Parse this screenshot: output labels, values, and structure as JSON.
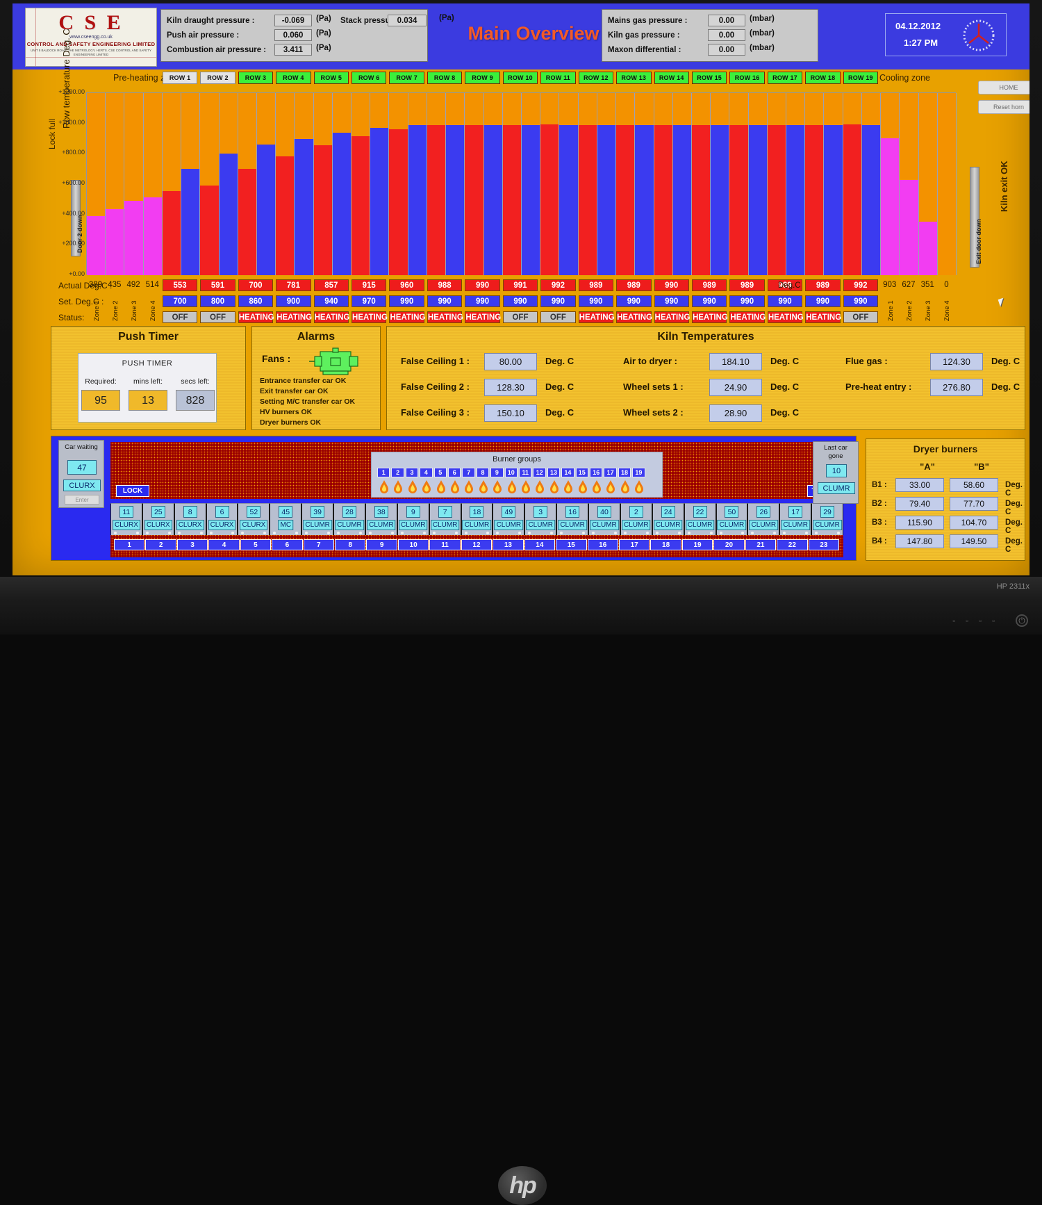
{
  "header": {
    "title": "Main Overview",
    "logo": {
      "name": "C S E",
      "url": "www.cseengg.co.uk",
      "subtitle": "CONTROL AND SAFETY ENGINEERING LIMITED",
      "fineprint": "UNIT 5 BALDOCK ROAD, THE METROLOGY, HERTS.\nCSE CONTROL AND SAFETY ENGINEERING LIMITED"
    },
    "pressures_left": [
      {
        "label": "Kiln draught pressure :",
        "value": "-0.069",
        "unit": "(Pa)"
      },
      {
        "label": "Push air pressure :",
        "value": "0.060",
        "unit": "(Pa)"
      },
      {
        "label": "Combustion air pressure :",
        "value": "3.411",
        "unit": "(Pa)"
      }
    ],
    "stack": {
      "label": "Stack pressure :",
      "value": "0.034",
      "unit": "(Pa)"
    },
    "pressures_right": [
      {
        "label": "Mains gas pressure :",
        "value": "0.00",
        "unit": "(mbar)"
      },
      {
        "label": "Kiln gas pressure :",
        "value": "0.00",
        "unit": "(mbar)"
      },
      {
        "label": "Maxon differential :",
        "value": "0.00",
        "unit": "(mbar)"
      }
    ],
    "clock": {
      "date": "04.12.2012",
      "time": "1:27 PM"
    }
  },
  "chart_region": {
    "preheat_label": "Pre-heating zone",
    "cooling_label": "Cooling zone",
    "lock_full_label": "Lock full",
    "kiln_exit_label": "Kiln exit OK",
    "door2_label": "Door 2 down",
    "exit_door_label": "Exit door down",
    "home_button": "HOME",
    "reset_horn_button": "Reset horn",
    "row_buttons": [
      {
        "label": "ROW 1",
        "state": "off"
      },
      {
        "label": "ROW 2",
        "state": "off"
      },
      {
        "label": "ROW 3",
        "state": "on"
      },
      {
        "label": "ROW 4",
        "state": "on"
      },
      {
        "label": "ROW 5",
        "state": "on"
      },
      {
        "label": "ROW 6",
        "state": "on"
      },
      {
        "label": "ROW 7",
        "state": "on"
      },
      {
        "label": "ROW 8",
        "state": "on"
      },
      {
        "label": "ROW 9",
        "state": "on"
      },
      {
        "label": "ROW 10",
        "state": "on"
      },
      {
        "label": "ROW 11",
        "state": "on"
      },
      {
        "label": "ROW 12",
        "state": "on"
      },
      {
        "label": "ROW 13",
        "state": "on"
      },
      {
        "label": "ROW 14",
        "state": "on"
      },
      {
        "label": "ROW 15",
        "state": "on"
      },
      {
        "label": "ROW 16",
        "state": "on"
      },
      {
        "label": "ROW 17",
        "state": "on"
      },
      {
        "label": "ROW 18",
        "state": "on"
      },
      {
        "label": "ROW 19",
        "state": "on"
      }
    ],
    "actual_label": "Actual Deg.C :",
    "set_label": "Set. Deg.C :",
    "status_label": "Status:",
    "degc_tail": "Deg.C",
    "preheat_zone_names": [
      "Zone 1",
      "Zone 2",
      "Zone 3",
      "Zone 4"
    ],
    "cooling_zone_names": [
      "Zone 1",
      "Zone 2",
      "Zone 3",
      "Zone 4"
    ],
    "preheat_actuals": [
      "389",
      "435",
      "492",
      "514"
    ],
    "cooling_actuals": [
      "903",
      "627",
      "351",
      "0"
    ]
  },
  "chart_data": {
    "type": "bar",
    "title": "Row temperature Deg. C",
    "ylabel": "Row temperature Deg. C",
    "xlabel": "",
    "ylim": [
      0,
      1200
    ],
    "yticks": [
      "+0.00",
      "+200.00",
      "+400.00",
      "+600.00",
      "+800.00",
      "+1000.00",
      "+1200.00"
    ],
    "grid": true,
    "legend": "none",
    "preheat": {
      "categories": [
        "Zone 1",
        "Zone 2",
        "Zone 3",
        "Zone 4"
      ],
      "values": [
        389,
        435,
        492,
        514
      ],
      "color": "#f23df2"
    },
    "rows": {
      "categories": [
        "ROW 1",
        "ROW 2",
        "ROW 3",
        "ROW 4",
        "ROW 5",
        "ROW 6",
        "ROW 7",
        "ROW 8",
        "ROW 9",
        "ROW 10",
        "ROW 11",
        "ROW 12",
        "ROW 13",
        "ROW 14",
        "ROW 15",
        "ROW 16",
        "ROW 17",
        "ROW 18",
        "ROW 19"
      ],
      "series": [
        {
          "name": "Actual Deg.C",
          "color": "#f22020",
          "values": [
            553,
            591,
            700,
            781,
            857,
            915,
            960,
            988,
            990,
            991,
            992,
            989,
            989,
            990,
            989,
            989,
            989,
            989,
            992
          ]
        },
        {
          "name": "Set. Deg.C",
          "color": "#3b3bf0",
          "values": [
            700,
            800,
            860,
            900,
            940,
            970,
            990,
            990,
            990,
            990,
            990,
            990,
            990,
            990,
            990,
            990,
            990,
            990,
            990
          ]
        }
      ],
      "status": [
        "OFF",
        "OFF",
        "HEATING",
        "HEATING",
        "HEATING",
        "HEATING",
        "HEATING",
        "HEATING",
        "HEATING",
        "OFF",
        "OFF",
        "HEATING",
        "HEATING",
        "HEATING",
        "HEATING",
        "HEATING",
        "HEATING",
        "HEATING",
        "OFF"
      ]
    },
    "cooling": {
      "categories": [
        "Zone 1",
        "Zone 2",
        "Zone 3",
        "Zone 4"
      ],
      "values": [
        903,
        627,
        351,
        0
      ],
      "color": "#f23df2"
    },
    "background_color": "#f39200",
    "plot_background": "#cdd3dc"
  },
  "push_timer": {
    "title": "Push Timer",
    "caption": "PUSH TIMER",
    "fields": [
      {
        "label": "Required:",
        "value": "95"
      },
      {
        "label": "mins left:",
        "value": "13"
      },
      {
        "label": "secs left:",
        "value": "828"
      }
    ]
  },
  "alarms": {
    "title": "Alarms",
    "fans_label": "Fans :",
    "items": [
      "Entrance transfer car OK",
      "Exit transfer car OK",
      "Setting M/C transfer car OK",
      "HV burners OK",
      "Dryer burners OK"
    ]
  },
  "kiln_temperatures": {
    "title": "Kiln Temperatures",
    "unit": "Deg. C",
    "col1": [
      {
        "label": "False Ceiling 1 :",
        "value": "80.00"
      },
      {
        "label": "False Ceiling 2 :",
        "value": "128.30"
      },
      {
        "label": "False Ceiling 3 :",
        "value": "150.10"
      }
    ],
    "col2": [
      {
        "label": "Air to dryer :",
        "value": "184.10"
      },
      {
        "label": "Wheel sets 1 :",
        "value": "24.90"
      },
      {
        "label": "Wheel sets 2 :",
        "value": "28.90"
      }
    ],
    "col3": [
      {
        "label": "Flue gas :",
        "value": "124.30"
      },
      {
        "label": "Pre-heat entry :",
        "value": "276.80"
      }
    ]
  },
  "car_track": {
    "car_waiting": {
      "title": "Car waiting",
      "value": "47",
      "code": "CLURX",
      "enter_label": "Enter"
    },
    "lock_button": "LOCK",
    "track_button": "TRACK",
    "burner_groups": {
      "title": "Burner groups",
      "numbers": [
        "1",
        "2",
        "3",
        "4",
        "5",
        "6",
        "7",
        "8",
        "9",
        "10",
        "11",
        "12",
        "13",
        "14",
        "15",
        "16",
        "17",
        "18",
        "19"
      ]
    },
    "last_car_gone": {
      "title_line1": "Last car",
      "title_line2": "gone",
      "value": "10",
      "code": "CLUMR"
    },
    "cars": [
      {
        "number": "11",
        "code": "CLURX"
      },
      {
        "number": "25",
        "code": "CLURX"
      },
      {
        "number": "8",
        "code": "CLURX"
      },
      {
        "number": "6",
        "code": "CLURX"
      },
      {
        "number": "52",
        "code": "CLURX"
      },
      {
        "number": "45",
        "code": "MC"
      },
      {
        "number": "39",
        "code": "CLUMR"
      },
      {
        "number": "28",
        "code": "CLUMR"
      },
      {
        "number": "38",
        "code": "CLUMR"
      },
      {
        "number": "9",
        "code": "CLUMR"
      },
      {
        "number": "7",
        "code": "CLUMR"
      },
      {
        "number": "18",
        "code": "CLUMR"
      },
      {
        "number": "49",
        "code": "CLUMR"
      },
      {
        "number": "3",
        "code": "CLUMR"
      },
      {
        "number": "16",
        "code": "CLUMR"
      },
      {
        "number": "40",
        "code": "CLUMR"
      },
      {
        "number": "2",
        "code": "CLUMR"
      },
      {
        "number": "24",
        "code": "CLUMR"
      },
      {
        "number": "22",
        "code": "CLUMR"
      },
      {
        "number": "50",
        "code": "CLUMR"
      },
      {
        "number": "26",
        "code": "CLUMR"
      },
      {
        "number": "17",
        "code": "CLUMR"
      },
      {
        "number": "29",
        "code": "CLUMR"
      }
    ],
    "positions": [
      "1",
      "2",
      "3",
      "4",
      "5",
      "6",
      "7",
      "8",
      "9",
      "10",
      "11",
      "12",
      "13",
      "14",
      "15",
      "16",
      "17",
      "18",
      "19",
      "20",
      "21",
      "22",
      "23"
    ]
  },
  "dryer_burners": {
    "title": "Dryer burners",
    "col_a": "\"A\"",
    "col_b": "\"B\"",
    "unit": "Deg. C",
    "rows": [
      {
        "label": "B1 :",
        "a": "33.00",
        "b": "58.60"
      },
      {
        "label": "B2 :",
        "a": "79.40",
        "b": "77.70"
      },
      {
        "label": "B3 :",
        "a": "115.90",
        "b": "104.70"
      },
      {
        "label": "B4 :",
        "a": "147.80",
        "b": "149.50"
      }
    ]
  },
  "monitor": {
    "model": "HP 2311x"
  },
  "colors": {
    "header_blue": "#3b3be0",
    "screen_orange": "#e8a100",
    "bar_actual_red": "#f22020",
    "bar_set_blue": "#3b3bf0",
    "bar_zone_magenta": "#f23df2",
    "bar_background_orange": "#f39200",
    "row_on_green": "#3bf03b",
    "title_orange": "#f25a28",
    "panel_amber": "#f2c12e"
  }
}
